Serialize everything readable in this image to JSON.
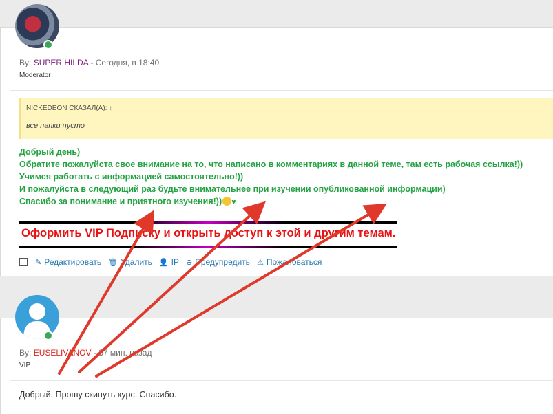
{
  "post1": {
    "by_label": "By:",
    "username": "SUPER HILDA",
    "dash": "-",
    "time": "Сегодня, в 18:40",
    "role": "Moderator",
    "quote": {
      "header": "NICKEDEON СКАЗАЛ(А): ↑",
      "text": "все папки пусто"
    },
    "message_lines": [
      "Добрый день)",
      "Обратите пожалуйста свое внимание на то, что написано в комментариях в данной теме, там есть рабочая ссылка!))",
      "Учимся работать с информацией самостоятельно!))",
      "И пожалуйста в следующий раз будьте внимательнее при изучении опубликованной информации)",
      "Спасибо за понимание и приятного изучения!))"
    ],
    "heart": "♥",
    "vip_banner": "Оформить VIP Подписку и открыть доступ к этой и другим темам.",
    "actions": {
      "edit": "Редактировать",
      "delete": "Удалить",
      "ip": "IP",
      "warn": "Предупредить",
      "report": "Пожаловаться"
    }
  },
  "post2": {
    "by_label": "By:",
    "username": "EUSELIVANOV",
    "dash": "-",
    "time": "37 мин. назад",
    "role": "VIP",
    "text": "Добрый. Прошу скинуть курс. Спасибо."
  },
  "colors": {
    "moderator_name": "#7d1f7a",
    "vip_name": "#d9261c",
    "message_green": "#23a342",
    "vip_banner_red": "#e81212",
    "link_blue": "#2577b1",
    "annotation_arrow": "#e0392b"
  },
  "icons": {
    "edit": "edit-icon",
    "delete": "trash-icon",
    "ip": "user-icon",
    "warn": "minus-circle-icon",
    "report": "warning-triangle-icon"
  }
}
